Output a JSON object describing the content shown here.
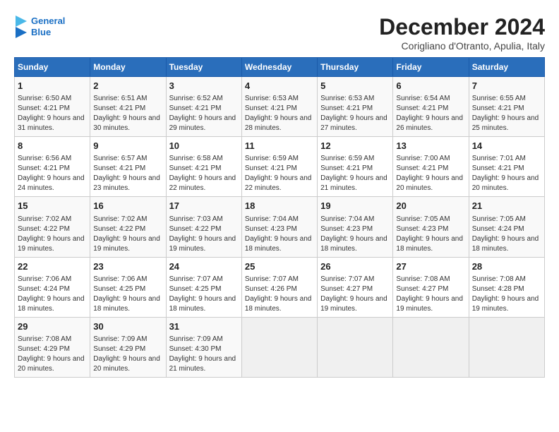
{
  "logo": {
    "line1": "General",
    "line2": "Blue"
  },
  "title": "December 2024",
  "location": "Corigliano d'Otranto, Apulia, Italy",
  "days_of_week": [
    "Sunday",
    "Monday",
    "Tuesday",
    "Wednesday",
    "Thursday",
    "Friday",
    "Saturday"
  ],
  "weeks": [
    [
      {
        "day": "1",
        "sunrise": "6:50 AM",
        "sunset": "4:21 PM",
        "daylight": "9 hours and 31 minutes."
      },
      {
        "day": "2",
        "sunrise": "6:51 AM",
        "sunset": "4:21 PM",
        "daylight": "9 hours and 30 minutes."
      },
      {
        "day": "3",
        "sunrise": "6:52 AM",
        "sunset": "4:21 PM",
        "daylight": "9 hours and 29 minutes."
      },
      {
        "day": "4",
        "sunrise": "6:53 AM",
        "sunset": "4:21 PM",
        "daylight": "9 hours and 28 minutes."
      },
      {
        "day": "5",
        "sunrise": "6:53 AM",
        "sunset": "4:21 PM",
        "daylight": "9 hours and 27 minutes."
      },
      {
        "day": "6",
        "sunrise": "6:54 AM",
        "sunset": "4:21 PM",
        "daylight": "9 hours and 26 minutes."
      },
      {
        "day": "7",
        "sunrise": "6:55 AM",
        "sunset": "4:21 PM",
        "daylight": "9 hours and 25 minutes."
      }
    ],
    [
      {
        "day": "8",
        "sunrise": "6:56 AM",
        "sunset": "4:21 PM",
        "daylight": "9 hours and 24 minutes."
      },
      {
        "day": "9",
        "sunrise": "6:57 AM",
        "sunset": "4:21 PM",
        "daylight": "9 hours and 23 minutes."
      },
      {
        "day": "10",
        "sunrise": "6:58 AM",
        "sunset": "4:21 PM",
        "daylight": "9 hours and 22 minutes."
      },
      {
        "day": "11",
        "sunrise": "6:59 AM",
        "sunset": "4:21 PM",
        "daylight": "9 hours and 22 minutes."
      },
      {
        "day": "12",
        "sunrise": "6:59 AM",
        "sunset": "4:21 PM",
        "daylight": "9 hours and 21 minutes."
      },
      {
        "day": "13",
        "sunrise": "7:00 AM",
        "sunset": "4:21 PM",
        "daylight": "9 hours and 20 minutes."
      },
      {
        "day": "14",
        "sunrise": "7:01 AM",
        "sunset": "4:21 PM",
        "daylight": "9 hours and 20 minutes."
      }
    ],
    [
      {
        "day": "15",
        "sunrise": "7:02 AM",
        "sunset": "4:22 PM",
        "daylight": "9 hours and 19 minutes."
      },
      {
        "day": "16",
        "sunrise": "7:02 AM",
        "sunset": "4:22 PM",
        "daylight": "9 hours and 19 minutes."
      },
      {
        "day": "17",
        "sunrise": "7:03 AM",
        "sunset": "4:22 PM",
        "daylight": "9 hours and 19 minutes."
      },
      {
        "day": "18",
        "sunrise": "7:04 AM",
        "sunset": "4:23 PM",
        "daylight": "9 hours and 18 minutes."
      },
      {
        "day": "19",
        "sunrise": "7:04 AM",
        "sunset": "4:23 PM",
        "daylight": "9 hours and 18 minutes."
      },
      {
        "day": "20",
        "sunrise": "7:05 AM",
        "sunset": "4:23 PM",
        "daylight": "9 hours and 18 minutes."
      },
      {
        "day": "21",
        "sunrise": "7:05 AM",
        "sunset": "4:24 PM",
        "daylight": "9 hours and 18 minutes."
      }
    ],
    [
      {
        "day": "22",
        "sunrise": "7:06 AM",
        "sunset": "4:24 PM",
        "daylight": "9 hours and 18 minutes."
      },
      {
        "day": "23",
        "sunrise": "7:06 AM",
        "sunset": "4:25 PM",
        "daylight": "9 hours and 18 minutes."
      },
      {
        "day": "24",
        "sunrise": "7:07 AM",
        "sunset": "4:25 PM",
        "daylight": "9 hours and 18 minutes."
      },
      {
        "day": "25",
        "sunrise": "7:07 AM",
        "sunset": "4:26 PM",
        "daylight": "9 hours and 18 minutes."
      },
      {
        "day": "26",
        "sunrise": "7:07 AM",
        "sunset": "4:27 PM",
        "daylight": "9 hours and 19 minutes."
      },
      {
        "day": "27",
        "sunrise": "7:08 AM",
        "sunset": "4:27 PM",
        "daylight": "9 hours and 19 minutes."
      },
      {
        "day": "28",
        "sunrise": "7:08 AM",
        "sunset": "4:28 PM",
        "daylight": "9 hours and 19 minutes."
      }
    ],
    [
      {
        "day": "29",
        "sunrise": "7:08 AM",
        "sunset": "4:29 PM",
        "daylight": "9 hours and 20 minutes."
      },
      {
        "day": "30",
        "sunrise": "7:09 AM",
        "sunset": "4:29 PM",
        "daylight": "9 hours and 20 minutes."
      },
      {
        "day": "31",
        "sunrise": "7:09 AM",
        "sunset": "4:30 PM",
        "daylight": "9 hours and 21 minutes."
      },
      null,
      null,
      null,
      null
    ]
  ]
}
